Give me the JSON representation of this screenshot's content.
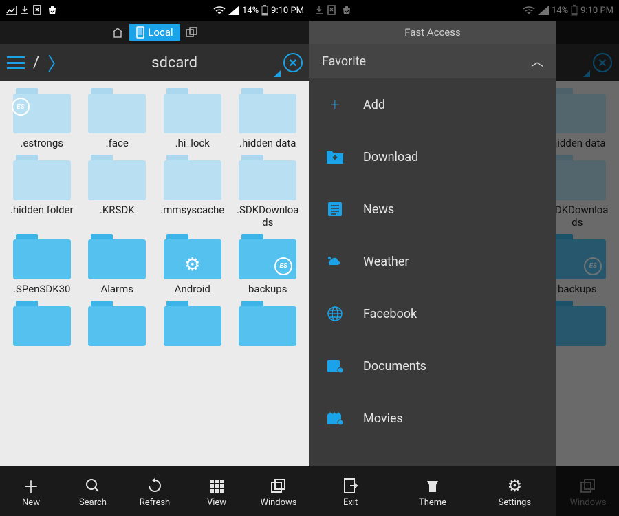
{
  "status": {
    "battery": "14%",
    "time": "9:10 PM"
  },
  "tabs": {
    "local": "Local"
  },
  "path": {
    "root": "/",
    "segment": "sdcard"
  },
  "folders": {
    "row1": [
      ".estrongs",
      ".face",
      ".hi_lock",
      ".hidden data"
    ],
    "row2": [
      ".hidden folder",
      ".KRSDK",
      ".mmsyscache",
      ".SDKDownloads"
    ],
    "row3": [
      ".SPenSDK30",
      "Alarms",
      "Android",
      "backups"
    ]
  },
  "bottomBar": [
    "New",
    "Search",
    "Refresh",
    "View",
    "Windows"
  ],
  "drawer": {
    "title": "Fast Access",
    "section": "Favorite",
    "items": [
      "Add",
      "Download",
      "News",
      "Weather",
      "Facebook",
      "Documents",
      "Movies"
    ],
    "bottom": [
      "Exit",
      "Theme",
      "Settings"
    ]
  },
  "rightVisibleFolders": [
    ".hidden data",
    ".SDKDownloads",
    "backups"
  ],
  "rightBottom": "Windows"
}
